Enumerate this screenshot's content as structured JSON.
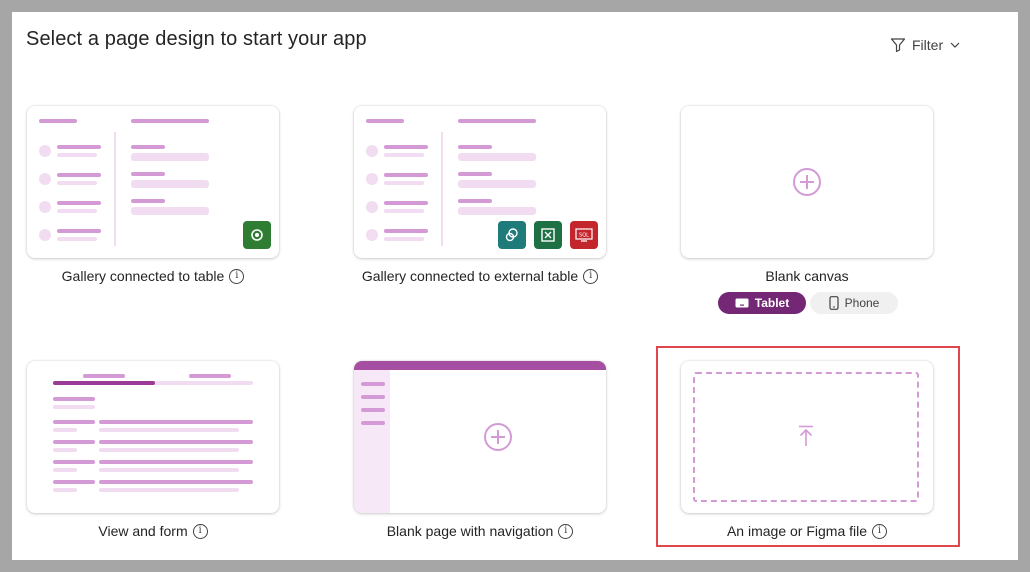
{
  "header": {
    "title": "Select a page design to start your app",
    "filter_label": "Filter"
  },
  "cards": [
    {
      "caption": "Gallery connected to table",
      "info": "i"
    },
    {
      "caption": "Gallery connected to external table",
      "info": "i"
    },
    {
      "caption": "Blank canvas",
      "info": ""
    },
    {
      "caption": "View and form",
      "info": "i"
    },
    {
      "caption": "Blank page with navigation",
      "info": "i"
    },
    {
      "caption": "An image or Figma file",
      "info": "i"
    }
  ],
  "layout_toggle": {
    "options": [
      "Tablet",
      "Phone"
    ],
    "selected": "Tablet"
  },
  "icons": {
    "dataverse": "dataverse-icon",
    "sharepoint": "sharepoint-icon",
    "excel": "excel-icon",
    "sql": "sql-icon",
    "add": "plus-circle-icon",
    "upload": "upload-arrow-icon"
  },
  "colors": {
    "accent": "#742774",
    "sketch_dark": "#d39ad6",
    "sketch_light": "#f1dcf2",
    "highlight": "#e0474c",
    "dataverse_tile": "#2e7d32",
    "sharepoint_tile": "#1f7a7a",
    "excel_tile": "#1e7145",
    "sql_tile": "#c4262e"
  }
}
